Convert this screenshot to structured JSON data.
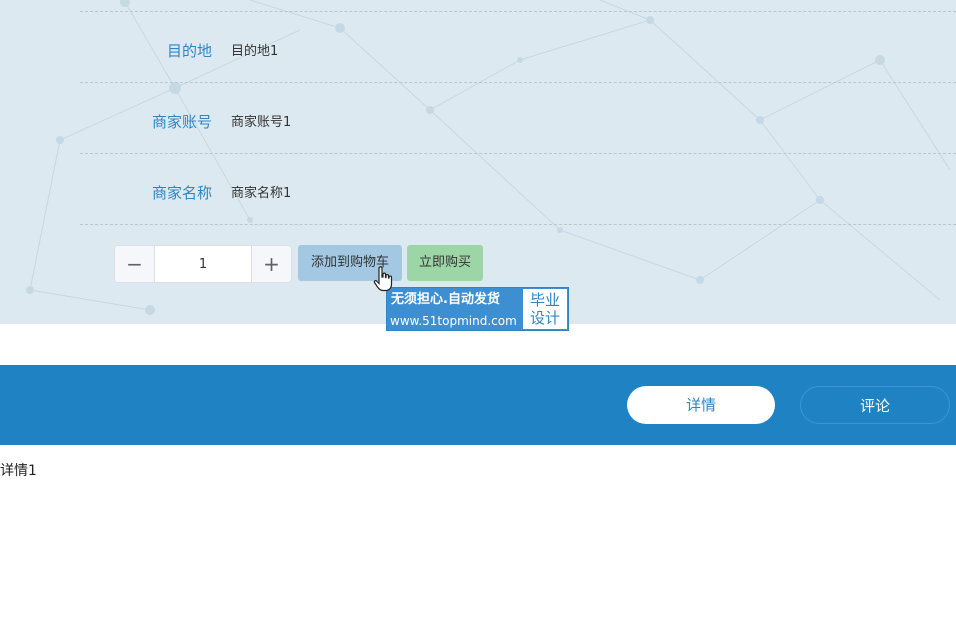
{
  "details": {
    "rows": [
      {
        "label": "目的地",
        "value": "目的地1"
      },
      {
        "label": "商家账号",
        "value": "商家账号1"
      },
      {
        "label": "商家名称",
        "value": "商家名称1"
      }
    ]
  },
  "purchase": {
    "quantity": "1",
    "decrement_icon": "minus-icon",
    "increment_icon": "plus-icon",
    "decrement_symbol": "−",
    "increment_symbol": "+",
    "add_to_cart_label": "添加到购物车",
    "buy_now_label": "立即购买"
  },
  "watermark": {
    "line1": "无须担心.自动发货",
    "line2": "www.51topmind.com",
    "badge_line1": "毕业",
    "badge_line2": "设计"
  },
  "tabs": [
    {
      "label": "详情"
    },
    {
      "label": "评论"
    }
  ],
  "content": {
    "text": "详情1"
  },
  "colors": {
    "primary": "#1f83c3",
    "label_blue": "#2e86c1",
    "cart_button": "#a3c8e3",
    "buy_button": "#9dd6a6",
    "background": "#dde9f1"
  }
}
